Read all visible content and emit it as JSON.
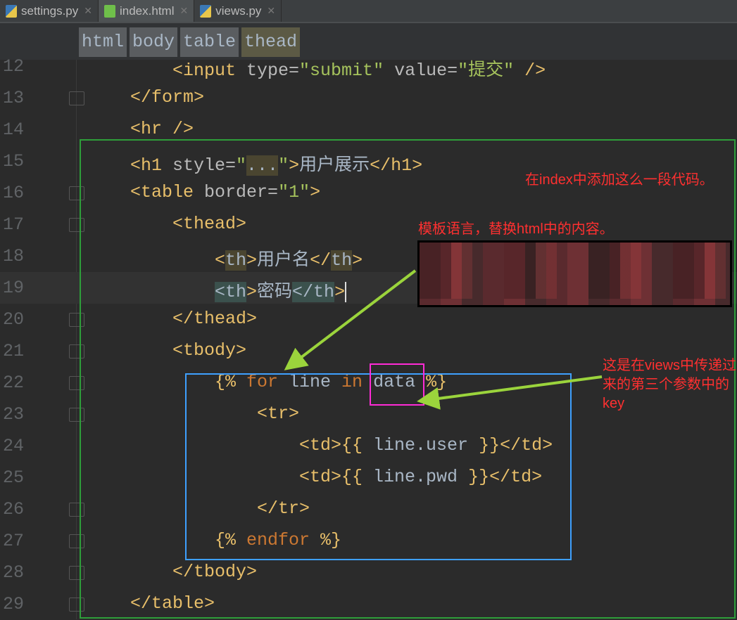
{
  "tabs": [
    {
      "label": "settings.py",
      "icon": "python-file-icon"
    },
    {
      "label": "index.html",
      "icon": "html-file-icon",
      "active": true
    },
    {
      "label": "views.py",
      "icon": "python-file-icon"
    }
  ],
  "breadcrumb": [
    "html",
    "body",
    "table",
    "thead"
  ],
  "lines": [
    {
      "n": "12",
      "indent": 1,
      "segs": [
        [
          "t",
          "<input "
        ],
        [
          "a",
          "type="
        ],
        [
          "v",
          "\"submit\" "
        ],
        [
          "a",
          "value="
        ],
        [
          "v",
          "\"提交\" "
        ],
        [
          "t",
          "/>"
        ]
      ]
    },
    {
      "n": "13",
      "indent": 0,
      "segs": [
        [
          "t",
          "</form>"
        ]
      ]
    },
    {
      "n": "14",
      "indent": 0,
      "segs": [
        [
          "t",
          "<hr />"
        ]
      ]
    },
    {
      "n": "15",
      "indent": 0,
      "segs": [
        [
          "t",
          "<h1 "
        ],
        [
          "a",
          "style="
        ],
        [
          "v",
          "\""
        ],
        [
          "hl2",
          "..."
        ],
        [
          "v",
          "\""
        ],
        [
          "t",
          ">"
        ],
        [
          "p",
          "用户展示"
        ],
        [
          "t",
          "</h1>"
        ]
      ]
    },
    {
      "n": "16",
      "indent": 0,
      "segs": [
        [
          "t",
          "<table "
        ],
        [
          "a",
          "border="
        ],
        [
          "v",
          "\"1\""
        ],
        [
          "t",
          ">"
        ]
      ]
    },
    {
      "n": "17",
      "indent": 1,
      "segs": [
        [
          "t",
          "<thead>"
        ]
      ]
    },
    {
      "n": "18",
      "indent": 2,
      "segs": [
        [
          "t",
          "<"
        ],
        [
          "hl2",
          "th"
        ],
        [
          "t",
          ">"
        ],
        [
          "p",
          "用户名"
        ],
        [
          "t",
          "</"
        ],
        [
          "hl2",
          "th"
        ],
        [
          "t",
          ">"
        ]
      ]
    },
    {
      "n": "19",
      "indent": 2,
      "segs": [
        [
          "hl",
          "<th"
        ],
        [
          "t",
          ">"
        ],
        [
          "p",
          "密码"
        ],
        [
          "hl",
          "</th"
        ],
        [
          "t",
          ">"
        ]
      ]
    },
    {
      "n": "20",
      "indent": 1,
      "segs": [
        [
          "t",
          "</thead>"
        ]
      ]
    },
    {
      "n": "21",
      "indent": 1,
      "segs": [
        [
          "t",
          "<tbody>"
        ]
      ]
    },
    {
      "n": "22",
      "indent": 2,
      "segs": [
        [
          "b",
          "{% "
        ],
        [
          "k",
          "for "
        ],
        [
          "p",
          "line "
        ],
        [
          "k",
          "in "
        ],
        [
          "p",
          "data "
        ],
        [
          "b",
          "%}"
        ]
      ]
    },
    {
      "n": "23",
      "indent": 3,
      "segs": [
        [
          "t",
          "<tr>"
        ]
      ]
    },
    {
      "n": "24",
      "indent": 4,
      "segs": [
        [
          "t",
          "<td>"
        ],
        [
          "b",
          "{{ "
        ],
        [
          "p",
          "line.user "
        ],
        [
          "b",
          "}}"
        ],
        [
          "t",
          "</td>"
        ]
      ]
    },
    {
      "n": "25",
      "indent": 4,
      "segs": [
        [
          "t",
          "<td>"
        ],
        [
          "b",
          "{{ "
        ],
        [
          "p",
          "line.pwd "
        ],
        [
          "b",
          "}}"
        ],
        [
          "t",
          "</td>"
        ]
      ]
    },
    {
      "n": "26",
      "indent": 3,
      "segs": [
        [
          "t",
          "</tr>"
        ]
      ]
    },
    {
      "n": "27",
      "indent": 2,
      "segs": [
        [
          "b",
          "{% "
        ],
        [
          "k",
          "endfor "
        ],
        [
          "b",
          "%}"
        ]
      ]
    },
    {
      "n": "28",
      "indent": 1,
      "segs": [
        [
          "t",
          "</tbody>"
        ]
      ]
    },
    {
      "n": "29",
      "indent": 0,
      "segs": [
        [
          "t",
          "</table>"
        ]
      ]
    }
  ],
  "annotations": {
    "note1": "在index中添加这么一段代码。",
    "note2": "模板语言，替换html中的内容。",
    "note3": "这是在views中传递过来的第三个参数中的key"
  },
  "colors": {
    "outer_box": "#2e9e3a",
    "inner_box": "#3ea0ff",
    "key_box": "#ff2bd6",
    "arrow": "#9bd43c",
    "note": "#ff3030"
  }
}
